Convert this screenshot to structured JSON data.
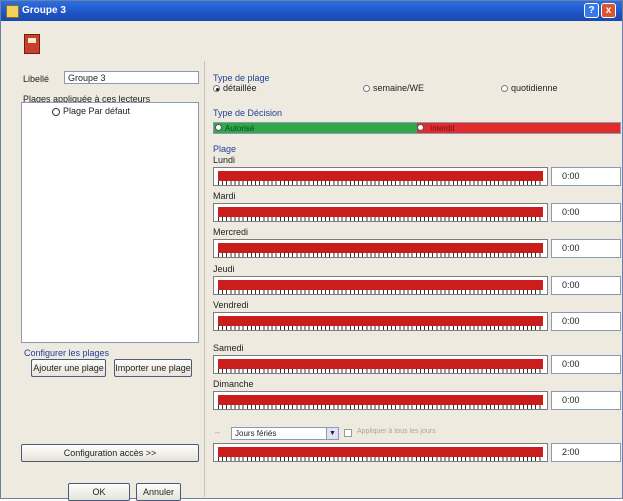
{
  "window": {
    "title": "Groupe 3",
    "help_label": "?",
    "close_label": "x"
  },
  "left": {
    "libelle_label": "Libellé",
    "libelle_value": "Groupe 3",
    "plages_label": "Plages appliquée à ces lecteurs",
    "plage_item": "Plage Par défaut",
    "configure_label": "Configurer les plages",
    "add_button": "Ajouter une plage",
    "import_button": "Importer une plage",
    "config_button": "Configuration accès >>",
    "ok_button": "OK",
    "cancel_button": "Annuler"
  },
  "right": {
    "type_plage_label": "Type de plage",
    "radio_options": [
      "détaillée",
      "semaine/WE",
      "quotidienne"
    ],
    "selected_option": "détaillée",
    "type_decision_label": "Type de Décision",
    "decision_allow_label": "Autorisé",
    "decision_deny_label": "Interdit",
    "plage_label": "Plage",
    "days": [
      {
        "name": "Lundi",
        "time": "0:00"
      },
      {
        "name": "Mardi",
        "time": "0:00"
      },
      {
        "name": "Mercredi",
        "time": "0:00"
      },
      {
        "name": "Jeudi",
        "time": "0:00"
      },
      {
        "name": "Vendredi",
        "time": "0:00"
      },
      {
        "name": "Samedi",
        "time": "0:00"
      },
      {
        "name": "Dimanche",
        "time": "0:00"
      }
    ],
    "holiday_select_value": "Jours fériés",
    "holiday_check_label": "Appliquer à tous les jours",
    "holiday_time": "2:00"
  },
  "colors": {
    "allow": "#2ea84a",
    "deny": "#e12c2c",
    "range": "#cc1d1d",
    "titlebar": "#1f55c6"
  }
}
